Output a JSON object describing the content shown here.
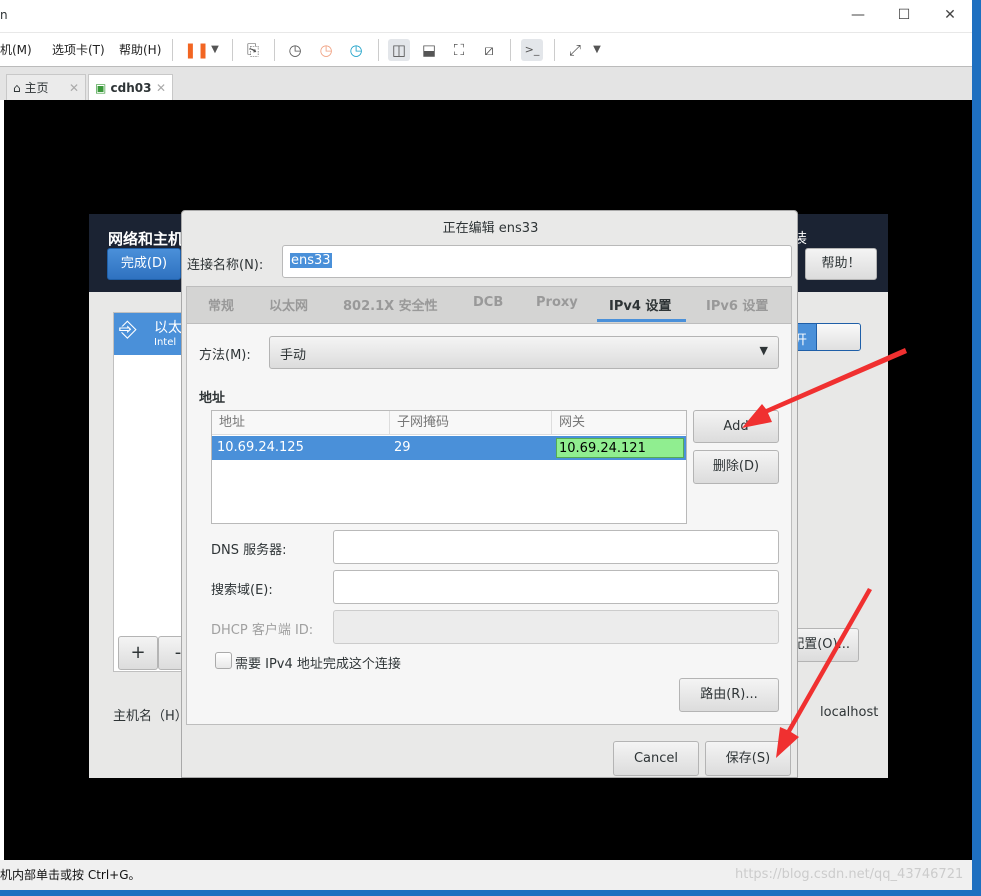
{
  "window": {
    "title_fragment": "n",
    "controls": [
      "—",
      "☐",
      "✕"
    ]
  },
  "menu": [
    "机(M)",
    "选项卡(T)",
    "帮助(H)"
  ],
  "toolbar_icons": [
    "pause-icon",
    "dropdown-icon",
    "send-keys-icon",
    "snapshot-icon",
    "revert-snapshot-icon",
    "manage-snapshot-icon",
    "sidebar-view-icon",
    "thumbnail-view-icon",
    "fullscreen-icon",
    "unity-icon",
    "console-icon",
    "stretch-icon"
  ],
  "tabs": [
    {
      "label": "主页",
      "close": "✕"
    },
    {
      "label": "cdh03",
      "close": "✕"
    }
  ],
  "installer": {
    "title": "网络和主机",
    "title_right": "装",
    "done_button": "完成(D)",
    "help_button": "帮助！",
    "device_name": "以太",
    "device_sub": "Intel",
    "add": "+",
    "remove": "-",
    "toggle_label": "开",
    "configure_button": "配置(O)...",
    "hostname_label": "主机名（H）",
    "hostname_value": "localhost"
  },
  "dialog": {
    "title": "正在编辑 ens33",
    "conn_name_label": "连接名称(N):",
    "conn_name_value": "ens33",
    "tabs": [
      "常规",
      "以太网",
      "802.1X 安全性",
      "DCB",
      "Proxy",
      "IPv4 设置",
      "IPv6 设置"
    ],
    "active_tab": "IPv4 设置",
    "method_label": "方法(M):",
    "method_value": "手动",
    "address_heading": "地址",
    "table": {
      "headers": [
        "地址",
        "子网掩码",
        "网关"
      ],
      "rows": [
        [
          "10.69.24.125",
          "29",
          "10.69.24.121"
        ]
      ]
    },
    "add_button": "Add",
    "delete_button": "删除(D)",
    "dns_label": "DNS 服务器:",
    "dns_value": "",
    "search_label": "搜索域(E):",
    "search_value": "",
    "dhcp_label": "DHCP 客户端 ID:",
    "dhcp_value": "",
    "require_checkbox": "需要 IPv4 地址完成这个连接",
    "require_checked": false,
    "routes_button": "路由(R)...",
    "cancel_button": "Cancel",
    "save_button": "保存(S)"
  },
  "statusbar": {
    "text": "机内部单击或按 Ctrl+G。",
    "watermark": "https://blog.csdn.net/qq_43746721"
  },
  "colors": {
    "accent": "#4a90d9",
    "selection": "#4a90d9",
    "editing_cell": "#90ee90",
    "arrow": "#f03030",
    "header_dark": "#1b2333"
  }
}
